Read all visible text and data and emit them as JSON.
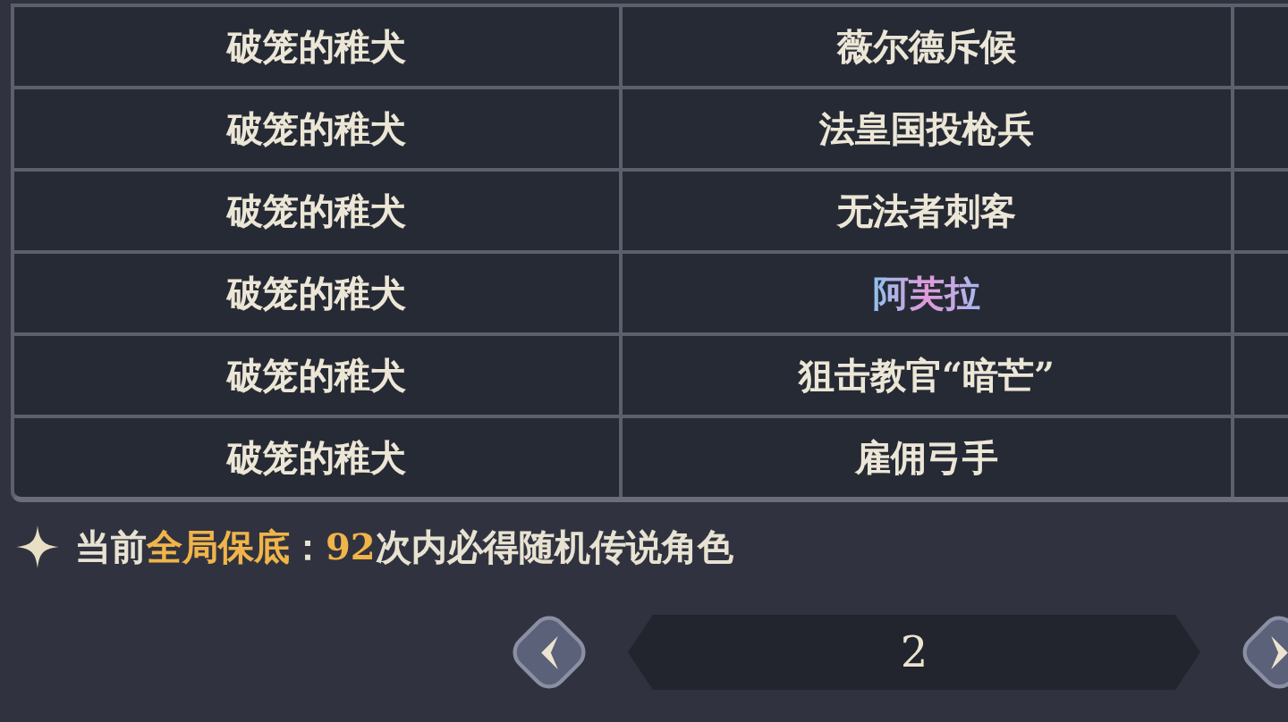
{
  "table": {
    "rows": [
      {
        "cells": [
          {
            "text": "破笼的稚犬",
            "kind": "normal"
          },
          {
            "text": "薇尔德斥候",
            "kind": "normal"
          }
        ]
      },
      {
        "cells": [
          {
            "text": "破笼的稚犬",
            "kind": "normal"
          },
          {
            "text": "法皇国投枪兵",
            "kind": "normal"
          }
        ]
      },
      {
        "cells": [
          {
            "text": "破笼的稚犬",
            "kind": "normal"
          },
          {
            "text": "无法者刺客",
            "kind": "normal"
          }
        ]
      },
      {
        "cells": [
          {
            "text": "破笼的稚犬",
            "kind": "normal"
          },
          {
            "text": "阿芙拉",
            "kind": "legendary"
          }
        ]
      },
      {
        "cells": [
          {
            "text": "破笼的稚犬",
            "kind": "normal"
          },
          {
            "text": "狙击教官“暗芒”",
            "kind": "normal"
          }
        ]
      },
      {
        "cells": [
          {
            "text": "破笼的稚犬",
            "kind": "normal"
          },
          {
            "text": "雇佣弓手",
            "kind": "normal"
          }
        ]
      }
    ]
  },
  "notice": "当前**全局保底**：**92**次内必得随机传说角色",
  "pagination": {
    "page": "2"
  }
}
